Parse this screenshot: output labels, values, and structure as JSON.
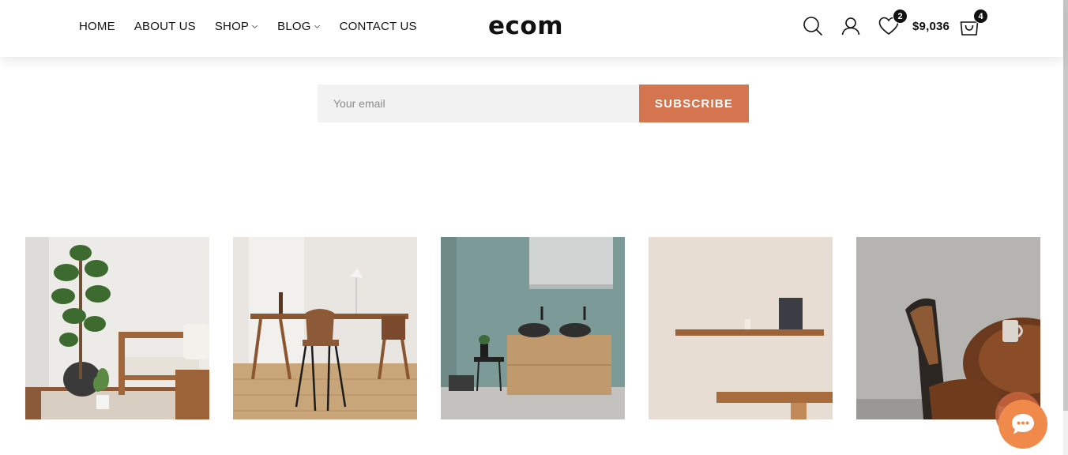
{
  "nav": {
    "items": [
      {
        "label": "HOME",
        "has_dropdown": false
      },
      {
        "label": "ABOUT US",
        "has_dropdown": false
      },
      {
        "label": "SHOP",
        "has_dropdown": true
      },
      {
        "label": "BLOG",
        "has_dropdown": true
      },
      {
        "label": "CONTACT US",
        "has_dropdown": false
      }
    ]
  },
  "logo": {
    "text": "ecom"
  },
  "header_icons": {
    "search": "search-icon",
    "account": "user-icon",
    "wishlist": {
      "icon": "heart-icon",
      "count": "2"
    },
    "cart": {
      "total": "$9,036",
      "icon": "shopping-bag-icon",
      "count": "4"
    }
  },
  "newsletter": {
    "placeholder": "Your email",
    "button_label": "SUBSCRIBE"
  },
  "gallery": {
    "tiles": [
      {
        "icon": "living-room-photo"
      },
      {
        "icon": "desk-chair-photo"
      },
      {
        "icon": "bathroom-vanity-photo"
      },
      {
        "icon": "wall-shelves-photo"
      },
      {
        "icon": "wooden-chair-table-photo"
      }
    ]
  },
  "chat": {
    "icon": "chat-bubble-icon"
  },
  "colors": {
    "accent": "#d4754f",
    "chat": "#f08a4b",
    "text": "#111111",
    "input_bg": "#f2f2f2"
  }
}
